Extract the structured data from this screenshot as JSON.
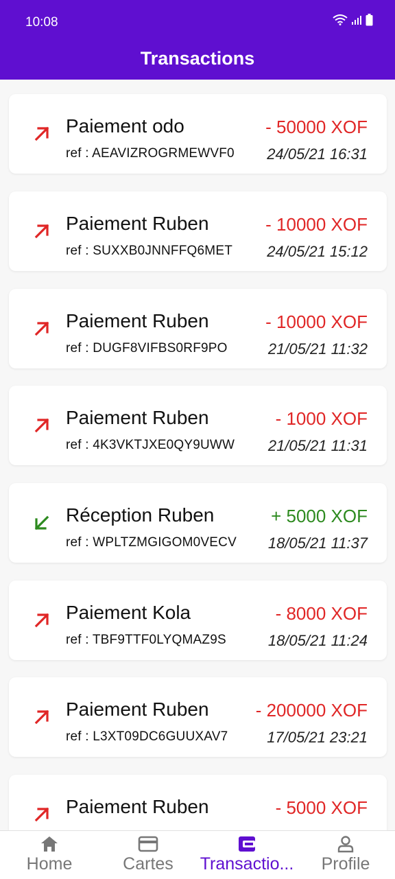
{
  "status_bar": {
    "time": "10:08"
  },
  "app_bar": {
    "title": "Transactions"
  },
  "colors": {
    "accent": "#5f0fd0",
    "debit": "#e02626",
    "credit": "#2d8a1f"
  },
  "transactions": [
    {
      "title": "Paiement odo",
      "ref": "ref : AEAVIZROGRMEWVF0",
      "amount": "- 50000 XOF",
      "date": "24/05/21 16:31",
      "direction": "out"
    },
    {
      "title": "Paiement Ruben",
      "ref": "ref : SUXXB0JNNFFQ6MET",
      "amount": "- 10000 XOF",
      "date": "24/05/21 15:12",
      "direction": "out"
    },
    {
      "title": "Paiement Ruben",
      "ref": "ref : DUGF8VIFBS0RF9PO",
      "amount": "- 10000 XOF",
      "date": "21/05/21 11:32",
      "direction": "out"
    },
    {
      "title": "Paiement Ruben",
      "ref": "ref : 4K3VKTJXE0QY9UWW",
      "amount": "- 1000 XOF",
      "date": "21/05/21 11:31",
      "direction": "out"
    },
    {
      "title": "Réception Ruben",
      "ref": "ref : WPLTZMGIGOM0VECV",
      "amount": "+ 5000 XOF",
      "date": "18/05/21 11:37",
      "direction": "in"
    },
    {
      "title": "Paiement Kola",
      "ref": "ref : TBF9TTF0LYQMAZ9S",
      "amount": "- 8000 XOF",
      "date": "18/05/21 11:24",
      "direction": "out"
    },
    {
      "title": "Paiement Ruben",
      "ref": "ref : L3XT09DC6GUUXAV7",
      "amount": "- 200000 XOF",
      "date": "17/05/21 23:21",
      "direction": "out"
    },
    {
      "title": "Paiement Ruben",
      "ref": "",
      "amount": "- 5000 XOF",
      "date": "",
      "direction": "out"
    }
  ],
  "bottom_nav": {
    "items": [
      {
        "label": "Home",
        "icon": "home-icon"
      },
      {
        "label": "Cartes",
        "icon": "card-icon"
      },
      {
        "label": "Transactio...",
        "icon": "wallet-icon",
        "active": true
      },
      {
        "label": "Profile",
        "icon": "person-icon"
      }
    ]
  }
}
